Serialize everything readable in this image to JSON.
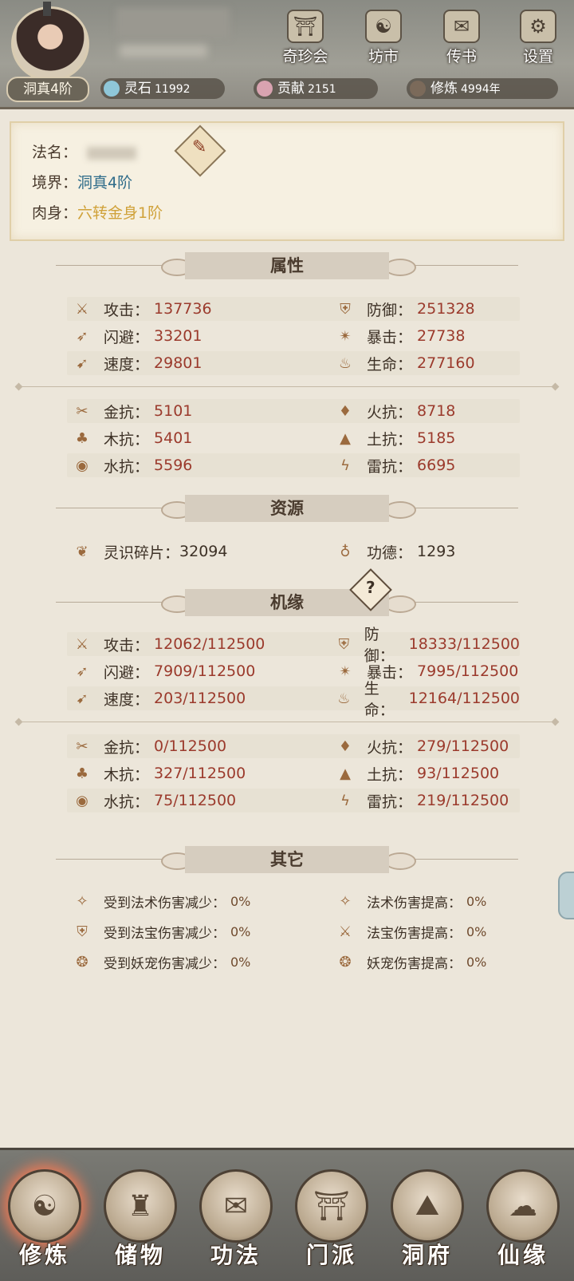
{
  "header": {
    "realm_badge": "洞真4阶",
    "buttons": [
      {
        "label": "奇珍会",
        "icon": "treasure-pavilion-icon"
      },
      {
        "label": "坊市",
        "icon": "market-icon"
      },
      {
        "label": "传书",
        "icon": "scroll-letter-icon"
      },
      {
        "label": "设置",
        "icon": "gear-icon"
      }
    ],
    "resources": [
      {
        "label": "灵石",
        "value": "11992"
      },
      {
        "label": "贡献",
        "value": "2151"
      },
      {
        "label": "修炼",
        "value": "4994年"
      }
    ]
  },
  "info": {
    "name_label": "法名：",
    "realm_label": "境界：",
    "realm_value": "洞真4阶",
    "body_label": "肉身：",
    "body_value": "六转金身1阶"
  },
  "sections": {
    "attributes": "属性",
    "resources": "资源",
    "fortune": "机缘",
    "other": "其它"
  },
  "attributes": [
    {
      "l_label": "攻击：",
      "l_val": "137736",
      "r_label": "防御：",
      "r_val": "251328"
    },
    {
      "l_label": "闪避：",
      "l_val": "33201",
      "r_label": "暴击：",
      "r_val": "27738"
    },
    {
      "l_label": "速度：",
      "l_val": "29801",
      "r_label": "生命：",
      "r_val": "277160"
    }
  ],
  "resistances": [
    {
      "l_label": "金抗：",
      "l_val": "5101",
      "r_label": "火抗：",
      "r_val": "8718"
    },
    {
      "l_label": "木抗：",
      "l_val": "5401",
      "r_label": "土抗：",
      "r_val": "5185"
    },
    {
      "l_label": "水抗：",
      "l_val": "5596",
      "r_label": "雷抗：",
      "r_val": "6695"
    }
  ],
  "resources_row": {
    "l_label": "灵识碎片：",
    "l_val": "32094",
    "r_label": "功德：",
    "r_val": "1293"
  },
  "fortune_attributes": [
    {
      "l_label": "攻击：",
      "l_val": "12062/112500",
      "r_label": "防御：",
      "r_val": "18333/112500"
    },
    {
      "l_label": "闪避：",
      "l_val": "7909/112500",
      "r_label": "暴击：",
      "r_val": "7995/112500"
    },
    {
      "l_label": "速度：",
      "l_val": "203/112500",
      "r_label": "生命：",
      "r_val": "12164/112500"
    }
  ],
  "fortune_resistances": [
    {
      "l_label": "金抗：",
      "l_val": "0/112500",
      "r_label": "火抗：",
      "r_val": "279/112500"
    },
    {
      "l_label": "木抗：",
      "l_val": "327/112500",
      "r_label": "土抗：",
      "r_val": "93/112500"
    },
    {
      "l_label": "水抗：",
      "l_val": "75/112500",
      "r_label": "雷抗：",
      "r_val": "219/112500"
    }
  ],
  "other": [
    {
      "l_label": "受到法术伤害减少：",
      "l_val": "0%",
      "r_label": "法术伤害提高：",
      "r_val": "0%"
    },
    {
      "l_label": "受到法宝伤害减少：",
      "l_val": "0%",
      "r_label": "法宝伤害提高：",
      "r_val": "0%"
    },
    {
      "l_label": "受到妖宠伤害减少：",
      "l_val": "0%",
      "r_label": "妖宠伤害提高：",
      "r_val": "0%"
    }
  ],
  "nav": [
    {
      "label": "修炼"
    },
    {
      "label": "储物"
    },
    {
      "label": "功法"
    },
    {
      "label": "门派"
    },
    {
      "label": "洞府"
    },
    {
      "label": "仙缘"
    }
  ],
  "colors": {
    "value_red": "#9b3a2c",
    "realm_blue": "#2f6c8a",
    "body_gold": "#d0a23a",
    "nav_active_glow": "#e87a57"
  }
}
